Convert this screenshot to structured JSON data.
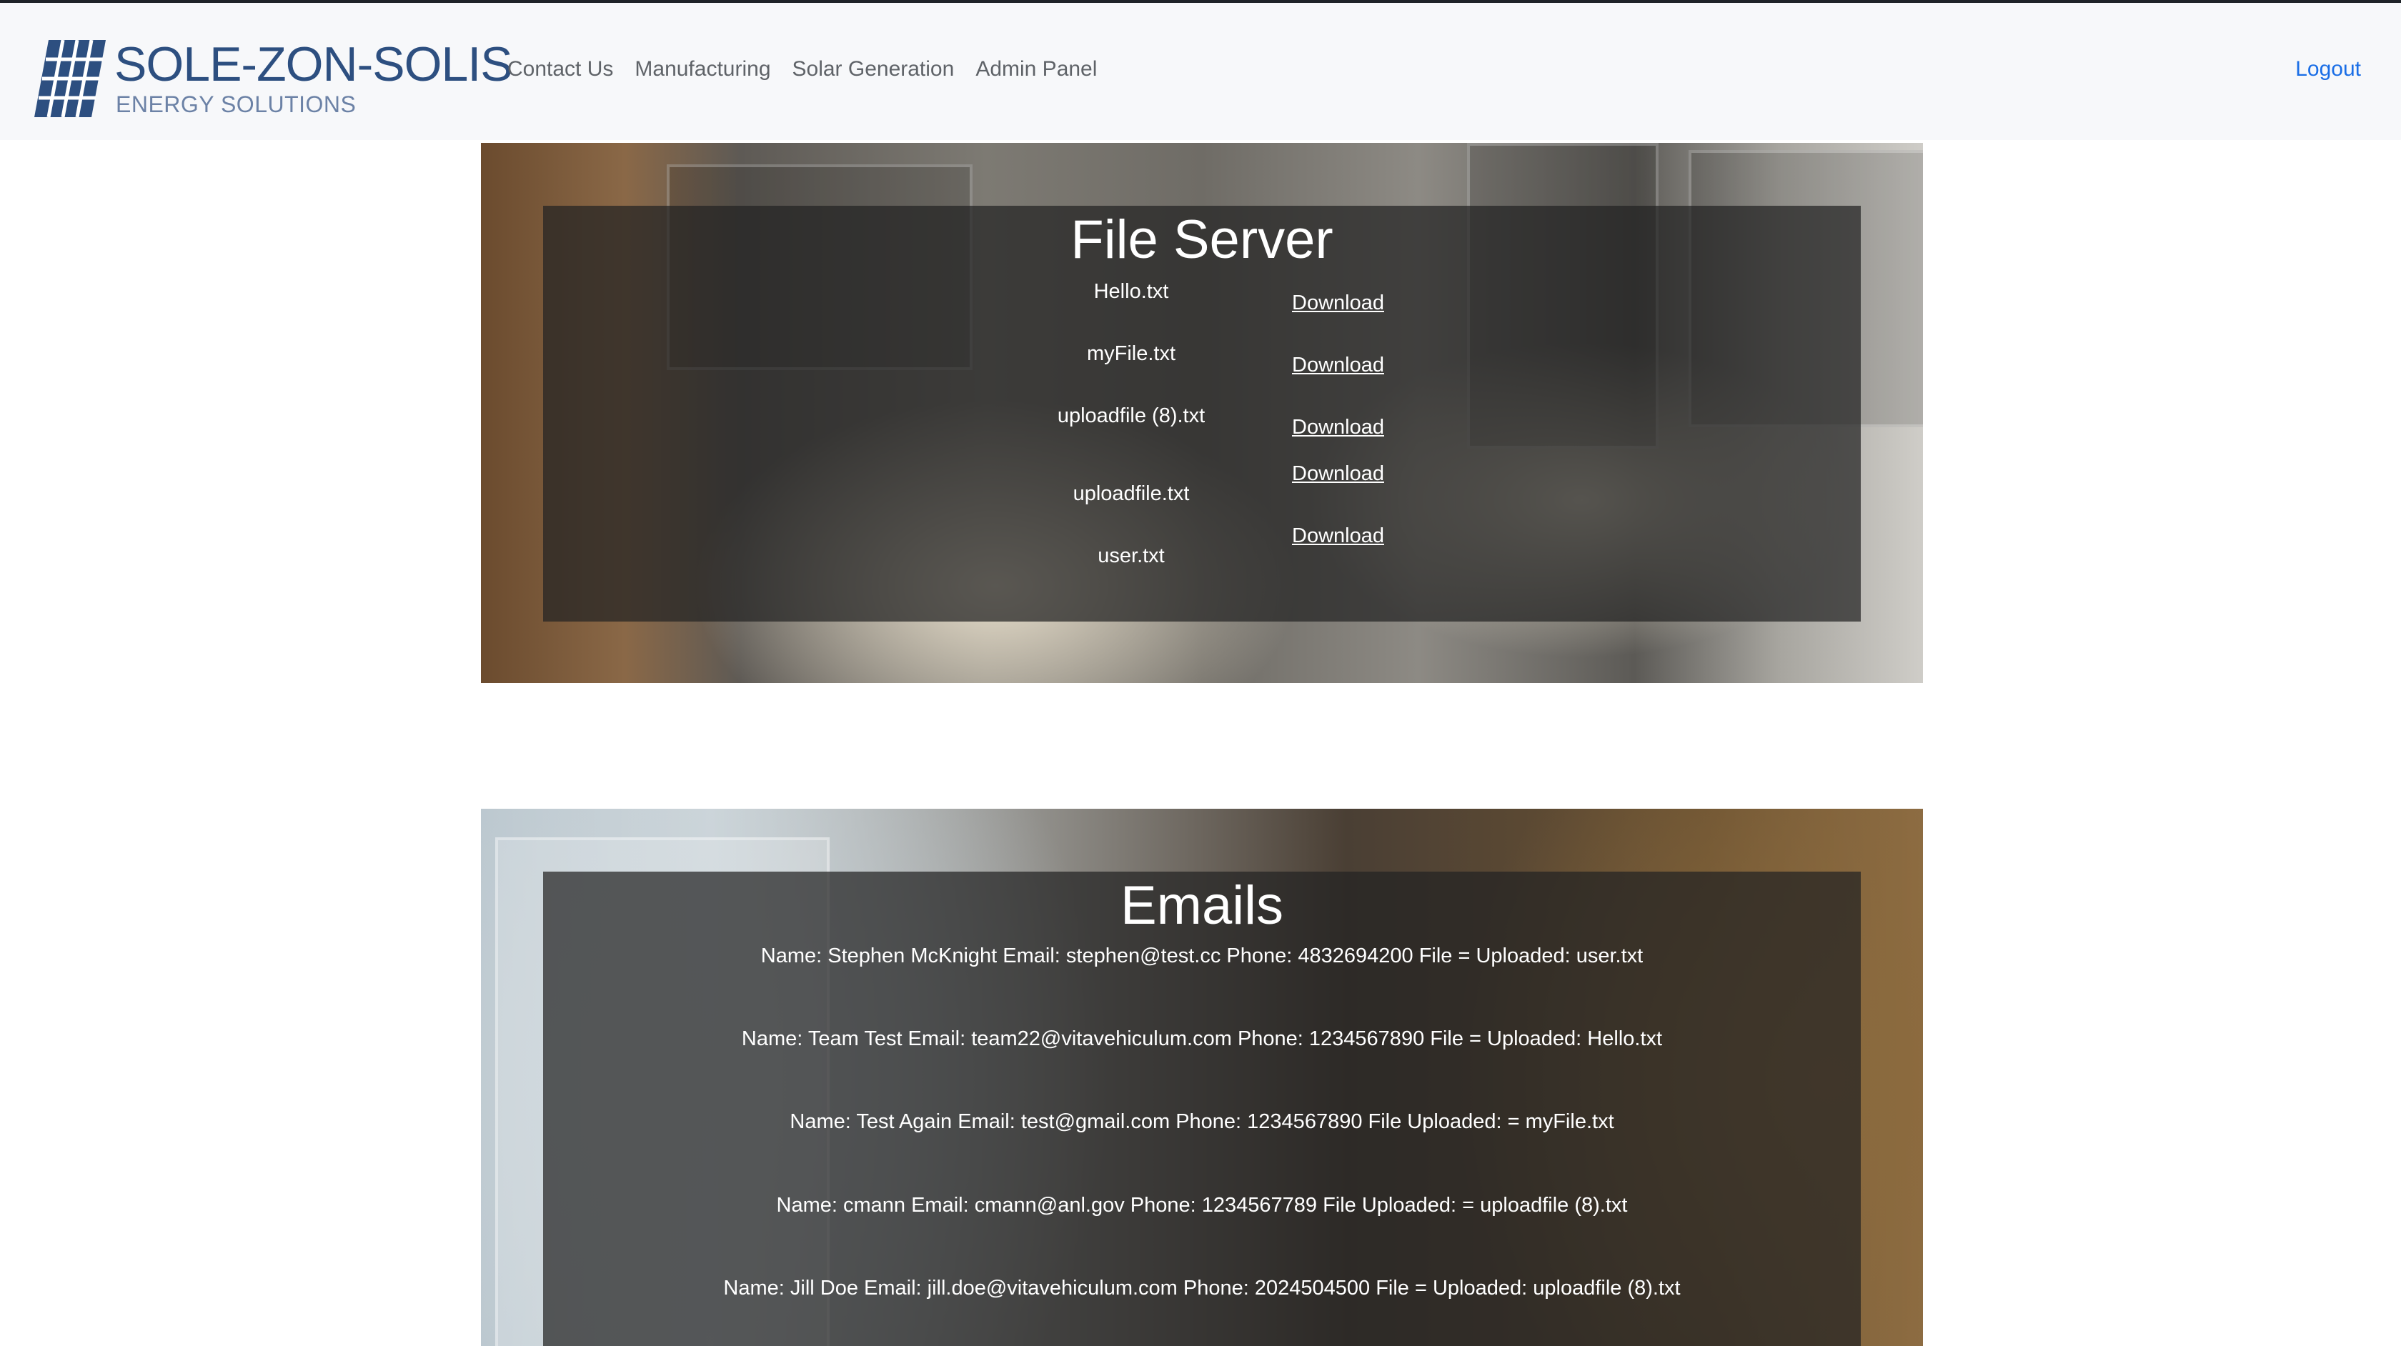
{
  "brand": {
    "title": "SOLE-ZON-SOLIS",
    "subtitle": "ENERGY SOLUTIONS",
    "colors": {
      "primary": "#2d4f80",
      "secondary": "#6c82a6"
    }
  },
  "nav": {
    "links": [
      "Contact Us",
      "Manufacturing",
      "Solar Generation",
      "Admin Panel"
    ],
    "logout": "Logout"
  },
  "file_server": {
    "title": "File Server",
    "download_label": "Download",
    "files": [
      {
        "name": "Hello.txt"
      },
      {
        "name": "myFile.txt"
      },
      {
        "name": "uploadfile (8).txt"
      },
      {
        "name": "uploadfile.txt"
      },
      {
        "name": "user.txt"
      }
    ]
  },
  "emails": {
    "title": "Emails",
    "entries": [
      "Name: Stephen McKnight Email: stephen@test.cc Phone: 4832694200 File = Uploaded: user.txt",
      "Name: Team Test Email: team22@vitavehiculum.com Phone: 1234567890 File = Uploaded: Hello.txt",
      "Name: Test Again Email: test@gmail.com Phone: 1234567890 File Uploaded: = myFile.txt",
      "Name: cmann Email: cmann@anl.gov Phone: 1234567789 File Uploaded: = uploadfile (8).txt",
      "Name: Jill Doe Email: jill.doe@vitavehiculum.com Phone: 2024504500 File = Uploaded: uploadfile (8).txt"
    ]
  },
  "icons": {
    "logo": "solar-panel-icon"
  }
}
